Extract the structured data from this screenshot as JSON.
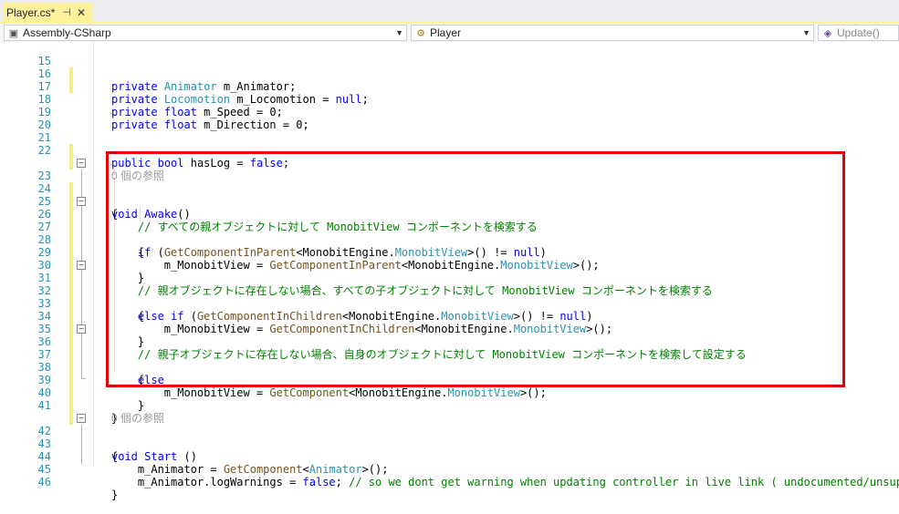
{
  "tab": {
    "title": "Player.cs*",
    "pin": "⊣",
    "close": "✕"
  },
  "nav": {
    "project": "Assembly-CSharp",
    "class": "Player",
    "member": "Update()",
    "project_icon": "csharp-project-icon",
    "class_icon": "class-icon",
    "member_icon": "method-icon"
  },
  "codelens": {
    "refs": "0 個の参照"
  },
  "lines": {
    "l15": {
      "no": "15",
      "a": "private",
      "b": " ",
      "c": "Animator",
      "d": " m_Animator;"
    },
    "l16": {
      "no": "16",
      "a": "private",
      "b": " ",
      "c": "Locomotion",
      "d": " m_Locomotion = ",
      "e": "null",
      "f": ";"
    },
    "l17": {
      "no": "17"
    },
    "l18": {
      "no": "18",
      "a": "private",
      "b": " ",
      "c": "float",
      "d": " m_Speed = 0;"
    },
    "l19": {
      "no": "19",
      "a": "private",
      "b": " ",
      "c": "float",
      "d": " m_Direction = 0;"
    },
    "l20": {
      "no": "20"
    },
    "l21": {
      "no": "21",
      "a": "public",
      "b": " ",
      "c": "bool",
      "d": " hasLog = ",
      "e": "false",
      "f": ";"
    },
    "l22": {
      "no": "22"
    },
    "l23": {
      "no": "23",
      "a": "void",
      "b": " ",
      "c": "Awake",
      "d": "()"
    },
    "l24": {
      "no": "24",
      "a": "{"
    },
    "l25": {
      "no": "25",
      "a": "    // すべての親オブジェクトに対して MonobitView コンポーネントを検索する"
    },
    "l26": {
      "no": "26",
      "a": "    ",
      "b": "if",
      "c": " (",
      "d": "GetComponentInParent",
      "e": "<MonobitEngine.",
      "f": "MonobitView",
      "g": ">() != ",
      "h": "null",
      "i": ")"
    },
    "l27": {
      "no": "27",
      "a": "    {"
    },
    "l28": {
      "no": "28",
      "a": "        m_MonobitView = ",
      "b": "GetComponentInParent",
      "c": "<MonobitEngine.",
      "d": "MonobitView",
      "e": ">();"
    },
    "l29": {
      "no": "29",
      "a": "    }"
    },
    "l30": {
      "no": "30",
      "a": "    // 親オブジェクトに存在しない場合、すべての子オブジェクトに対して MonobitView コンポーネントを検索する"
    },
    "l31": {
      "no": "31",
      "a": "    ",
      "b": "else if",
      "c": " (",
      "d": "GetComponentInChildren",
      "e": "<MonobitEngine.",
      "f": "MonobitView",
      "g": ">() != ",
      "h": "null",
      "i": ")"
    },
    "l32": {
      "no": "32",
      "a": "    {"
    },
    "l33": {
      "no": "33",
      "a": "        m_MonobitView = ",
      "b": "GetComponentInChildren",
      "c": "<MonobitEngine.",
      "d": "MonobitView",
      "e": ">();"
    },
    "l34": {
      "no": "34",
      "a": "    }"
    },
    "l35": {
      "no": "35",
      "a": "    // 親子オブジェクトに存在しない場合、自身のオブジェクトに対して MonobitView コンポーネントを検索して設定する"
    },
    "l36": {
      "no": "36",
      "a": "    ",
      "b": "else"
    },
    "l37": {
      "no": "37",
      "a": "    {"
    },
    "l38": {
      "no": "38",
      "a": "        m_MonobitView = ",
      "b": "GetComponent",
      "c": "<MonobitEngine.",
      "d": "MonobitView",
      "e": ">();"
    },
    "l39": {
      "no": "39",
      "a": "    }"
    },
    "l40": {
      "no": "40",
      "a": "}"
    },
    "l41": {
      "no": "41"
    },
    "l42": {
      "no": "42",
      "a": "void",
      "b": " ",
      "c": "Start",
      "d": " ()"
    },
    "l43": {
      "no": "43",
      "a": "{"
    },
    "l44": {
      "no": "44",
      "a": "    m_Animator = ",
      "b": "GetComponent",
      "c": "<",
      "d": "Animator",
      "e": ">();"
    },
    "l45": {
      "no": "45",
      "a": "    m_Animator.logWarnings = ",
      "b": "false",
      "c": "; ",
      "d": "// so we dont get warning when updating controller in live link ( undocumented/unsupported"
    },
    "l46": {
      "no": "46",
      "a": "}"
    }
  }
}
